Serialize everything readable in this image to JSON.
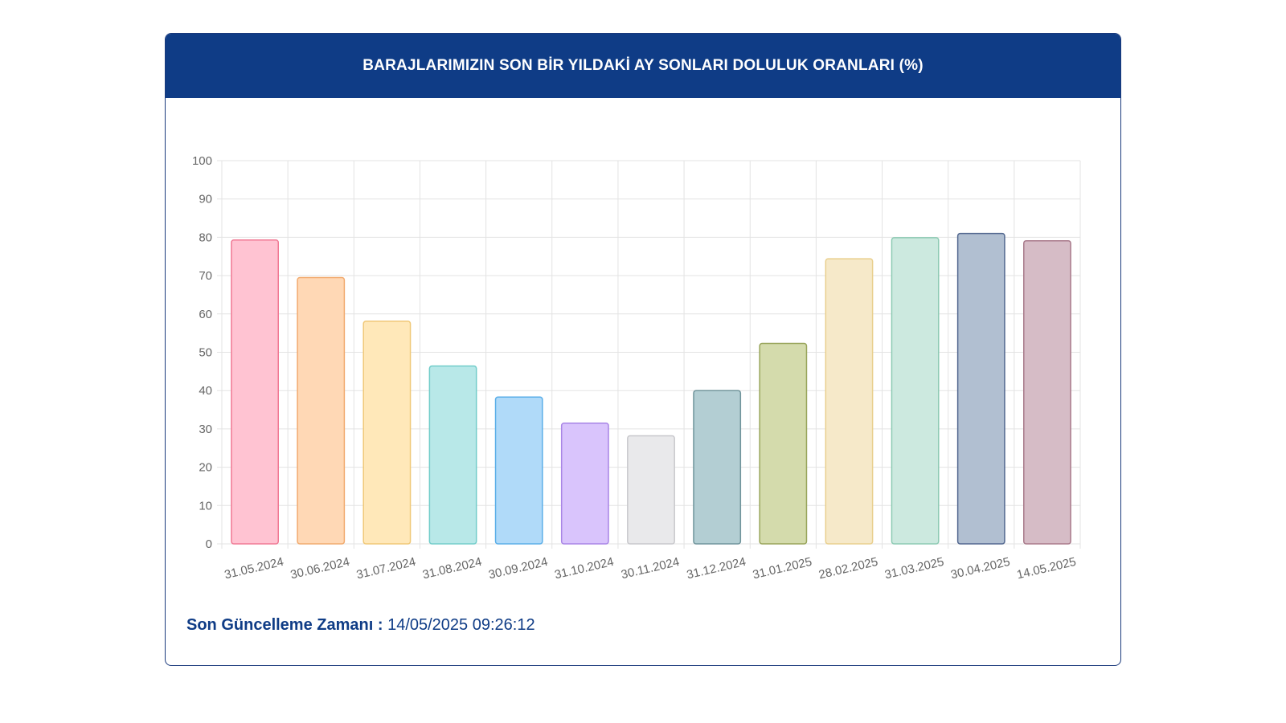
{
  "header": {
    "title": "BARAJLARIMIZIN SON BİR YILDAKİ AY SONLARI DOLULUK ORANLARI (%)"
  },
  "footer": {
    "label": "Son Güncelleme Zamanı :",
    "value": "14/05/2025 09:26:12"
  },
  "chart_data": {
    "type": "bar",
    "categories": [
      "31.05.2024",
      "30.06.2024",
      "31.07.2024",
      "31.08.2024",
      "30.09.2024",
      "31.10.2024",
      "30.11.2024",
      "31.12.2024",
      "31.01.2025",
      "28.02.2025",
      "31.03.2025",
      "30.04.2025",
      "14.05.2025"
    ],
    "values": [
      79.3,
      69.5,
      58.1,
      46.4,
      38.3,
      31.5,
      28.2,
      40.0,
      52.3,
      74.4,
      79.9,
      81.0,
      79.1
    ],
    "ylim": [
      0,
      100
    ],
    "yticks": [
      0,
      10,
      20,
      30,
      40,
      50,
      60,
      70,
      80,
      90,
      100
    ],
    "grid": true,
    "legend": "none",
    "colors": {
      "fill": [
        "#ffc3d2",
        "#ffd8b5",
        "#ffe8b9",
        "#b8e8e8",
        "#b0daf9",
        "#d9c4fc",
        "#e9e9eb",
        "#b3ced3",
        "#d4dbac",
        "#f6e9c9",
        "#cce9df",
        "#b1bfd1",
        "#d6bcc6"
      ],
      "stroke": [
        "#f07994",
        "#f1aa6e",
        "#f0c877",
        "#72cdca",
        "#5aaee8",
        "#a884e6",
        "#c8c8cc",
        "#6f949b",
        "#98a45a",
        "#e9cf8d",
        "#8ccab3",
        "#52678f",
        "#a8798a"
      ]
    }
  }
}
